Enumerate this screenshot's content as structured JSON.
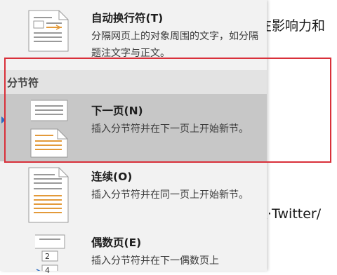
{
  "document": {
    "line1": "在影响力和",
    "line2": "案·Twitter/"
  },
  "menu": {
    "text_wrapping": {
      "title": "自动换行符(T)",
      "desc": "分隔网页上的对象周围的文字，如分隔题注文字与正文。"
    },
    "section_header": "分节符",
    "items": [
      {
        "title": "下一页(N)",
        "desc": "插入分节符并在下一页上开始新节。",
        "selected": true
      },
      {
        "title": "连续(O)",
        "desc": "插入分节符并在同一页上开始新节。"
      },
      {
        "title": "偶数页(E)",
        "desc": "插入分节符并在下一偶数页上",
        "thumb_numbers": [
          "2",
          "4"
        ]
      }
    ]
  },
  "colors": {
    "highlight_border": "#d9303a",
    "selected_bg": "#c7c7c7",
    "accent_arrow": "#2b6cc4",
    "thumb_orange": "#e39a3a"
  }
}
